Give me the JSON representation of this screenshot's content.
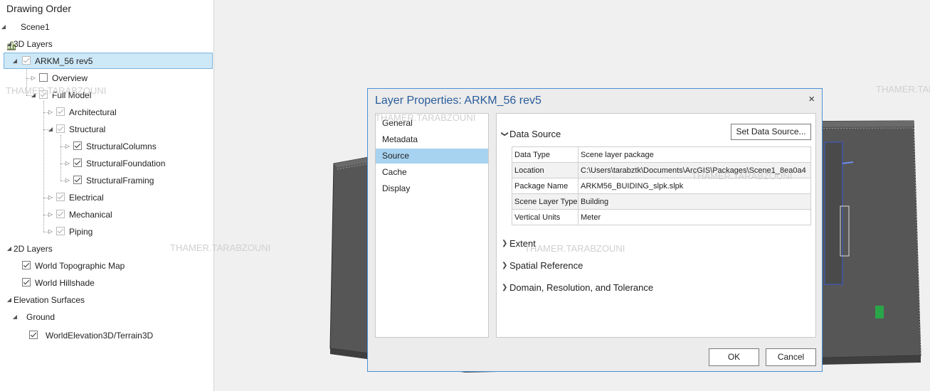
{
  "toc": {
    "header": "Drawing Order",
    "scene": "Scene1",
    "groups": {
      "layers3d": "3D Layers",
      "layers2d": "2D Layers",
      "elevation": "Elevation Surfaces",
      "ground": "Ground"
    },
    "layer_arkm": "ARKM_56 rev5",
    "overview": "Overview",
    "full_model": "Full Model",
    "architectural": "Architectural",
    "structural": "Structural",
    "structural_columns": "StructuralColumns",
    "structural_foundation": "StructuralFoundation",
    "structural_framing": "StructuralFraming",
    "electrical": "Electrical",
    "mechanical": "Mechanical",
    "piping": "Piping",
    "world_topo": "World Topographic Map",
    "world_hillshade": "World Hillshade",
    "world_elevation": "WorldElevation3D/Terrain3D"
  },
  "watermark": "THAMER.TARABZOUNI",
  "dialog": {
    "title": "Layer Properties: ARKM_56 rev5",
    "close": "×",
    "nav": [
      "General",
      "Metadata",
      "Source",
      "Cache",
      "Display"
    ],
    "active_nav": "Source",
    "data_source_title": "Data Source",
    "set_data_source": "Set Data Source...",
    "props": [
      {
        "key": "Data Type",
        "value": "Scene layer package"
      },
      {
        "key": "Location",
        "value": "C:\\Users\\tarabztk\\Documents\\ArcGIS\\Packages\\Scene1_8ea0a4"
      },
      {
        "key": "Package Name",
        "value": "ARKM56_BUIDING_slpk.slpk"
      },
      {
        "key": "Scene Layer Type",
        "value": "Building"
      },
      {
        "key": "Vertical Units",
        "value": "Meter"
      }
    ],
    "sections": [
      "Extent",
      "Spatial Reference",
      "Domain, Resolution, and Tolerance"
    ],
    "ok": "OK",
    "cancel": "Cancel"
  },
  "colors": {
    "dialog_border": "#4b8fd4",
    "title_blue": "#2a5d9a",
    "selection": "#a7d2f0",
    "building": "#5a5a5a"
  }
}
